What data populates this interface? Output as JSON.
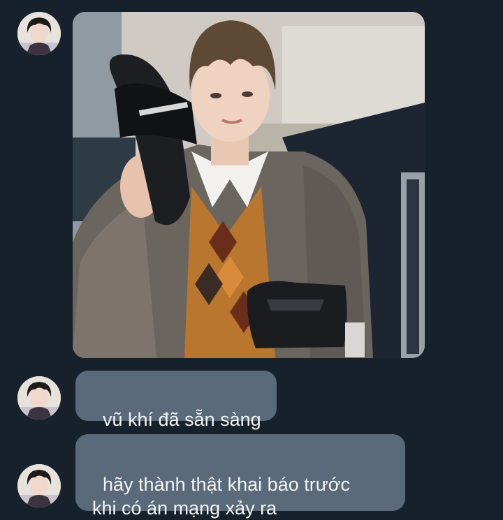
{
  "chat": {
    "messages": [
      {
        "type": "photo",
        "sender_avatar": "avatar-icon",
        "photo_subject": "photo-icon"
      },
      {
        "type": "text",
        "text": "vũ khí đã sẵn sàng",
        "sender_avatar": "avatar-icon"
      },
      {
        "type": "text",
        "text": "hãy thành thật khai báo trước\nkhi có án mạng xảy ra",
        "sender_avatar": "avatar-icon"
      }
    ]
  },
  "colors": {
    "background": "#17212b",
    "bubble": "#5a6a7b",
    "bubble_text": "#f2f4f6"
  }
}
